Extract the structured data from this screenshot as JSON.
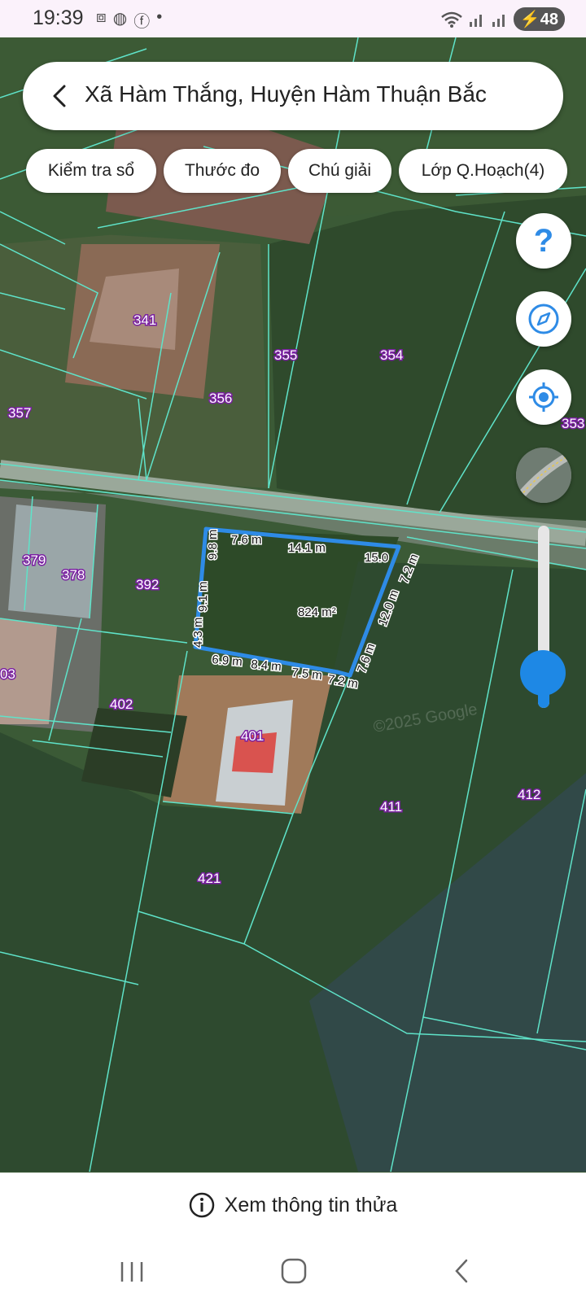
{
  "status_bar": {
    "time": "19:39",
    "icons": [
      "screenshot-icon",
      "globe-icon",
      "facebook-icon",
      "dot-icon"
    ],
    "right_icons": [
      "wifi-icon",
      "signal-icon",
      "signal-icon"
    ],
    "battery": "48"
  },
  "search": {
    "title": "Xã Hàm Thắng, Huyện Hàm Thuận Bắc"
  },
  "chips": [
    {
      "label": "Kiểm tra sổ"
    },
    {
      "label": "Thước đo"
    },
    {
      "label": "Chú giải"
    },
    {
      "label": "Lớp Q.Hoạch(4)"
    }
  ],
  "map_controls": {
    "help_label": "?",
    "icons": [
      "help-icon",
      "compass-icon",
      "locate-icon",
      "map-layer-thumbnail"
    ],
    "zoom_level_fraction": 0.25
  },
  "parcels": {
    "p341": "341",
    "p355": "355",
    "p354": "354",
    "p356": "356",
    "p357": "357",
    "p353": "353",
    "p379": "379",
    "p378": "378",
    "p392": "392",
    "p403": "03",
    "p402": "402",
    "p401": "401",
    "p411": "411",
    "p412": "412",
    "p421": "421"
  },
  "measurements": {
    "m1": "7.6 m",
    "m2": "14.1 m",
    "m3": "15.0",
    "m4": "7.2 m",
    "m5": "9.8 m",
    "m6": "9.1 m",
    "m7": "4.3 m",
    "m8": "12.0 m",
    "m9": "7.6 m",
    "m10": "6.9 m",
    "m11": "8.4 m",
    "m12": "7.5 m",
    "m13": "7.2 m",
    "area": "824 m²"
  },
  "watermark": "©2025 Google",
  "bottom": {
    "info_label": "Xem thông tin thửa"
  },
  "colors": {
    "parcel_line": "#5fe3c9",
    "selection": "#2e8be6",
    "accent": "#1e88e5"
  }
}
